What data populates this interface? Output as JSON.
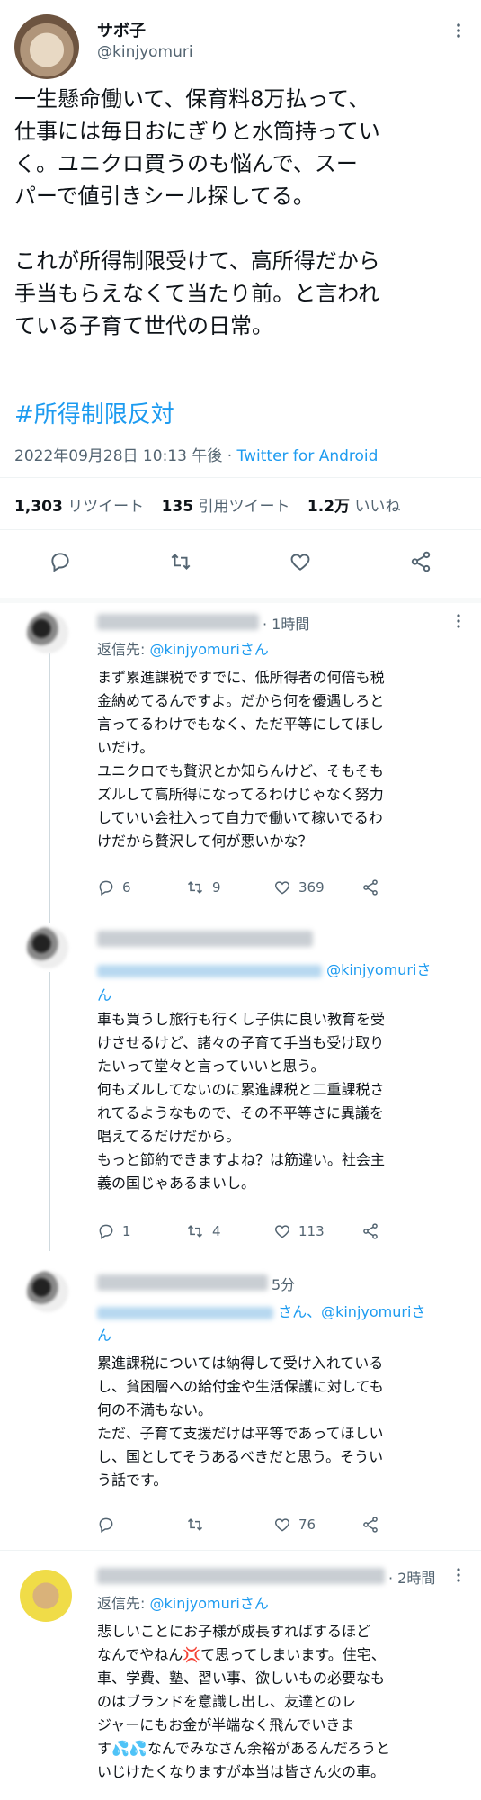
{
  "main": {
    "name": "サボ子",
    "handle": "@kinjyomuri",
    "text": "一生懸命働いて、保育料8万払って、\n仕事には毎日おにぎりと水筒持ってい\nく。ユニクロ買うのも悩んで、スー\nパーで値引きシール探してる。\n\nこれが所得制限受けて、高所得だから\n手当もらえなくて当たり前。と言われ\nている子育て世代の日常。",
    "hashtag": "#所得制限反対",
    "timestamp": "2022年09月28日 10:13 午後",
    "separator": " · ",
    "client": "Twitter for Android",
    "stats": {
      "retweets": "1,303",
      "retweets_label": "リツイート",
      "quotes": "135",
      "quotes_label": "引用ツイート",
      "likes": "1.2万",
      "likes_label": "いいね"
    }
  },
  "replies": [
    {
      "time": "· 1時間",
      "reply_to_prefix": "返信先: ",
      "reply_to": "@kinjyomuriさん",
      "text": "まず累進課税ですでに、低所得者の何倍も税\n金納めてるんですよ。だから何を優遇しろと\n言ってるわけでもなく、ただ平等にしてほし\nいだけ。\nユニクロでも贅沢とか知らんけど、そもそも\nズルして高所得になってるわけじゃなく努力\nしていい会社入って自力で働いて稼いでるわ\nけだから贅沢して何が悪いかな？",
      "replies": "6",
      "retweets": "9",
      "likes": "369"
    },
    {
      "reply_to": "@kinjyomuriさ",
      "reply_to_cont": "ん",
      "text": "車も買うし旅行も行くし子供に良い教育を受\nけさせるけど、諸々の子育て手当も受け取り\nたいって堂々と言っていいと思う。\n何もズルしてないのに累進課税と二重課税さ\nれてるようなもので、その不平等さに異議を\n唱えてるだけだから。\nもっと節約できますよね？は筋違い。社会主\n義の国じゃあるまいし。",
      "replies": "1",
      "retweets": "4",
      "likes": "113"
    },
    {
      "time": "5分",
      "reply_to": "さん、@kinjyomuriさ",
      "reply_to_cont": "ん",
      "text": "累進課税については納得して受け入れている\nし、貧困層への給付金や生活保護に対しても\n何の不満もない。\nただ、子育て支援だけは平等であってほしい\nし、国としてそうあるべきだと思う。そうい\nう話です。",
      "likes": "76"
    },
    {
      "time": "· 2時間",
      "reply_to_prefix": "返信先: ",
      "reply_to": "@kinjyomuriさん",
      "text": "悲しいことにお子様が成長すればするほど\nなんでやねん💢て思ってしまいます。住宅、\n車、学費、塾、習い事、欲しいもの必要なも\nのはブランドを意識し出し、友達とのレ\nジャーにもお金が半端なく飛んでいきま\nす💦💦なんでみなさん余裕があるんだろうと\nいじけたくなりますが本当は皆さん火の車。"
    }
  ]
}
